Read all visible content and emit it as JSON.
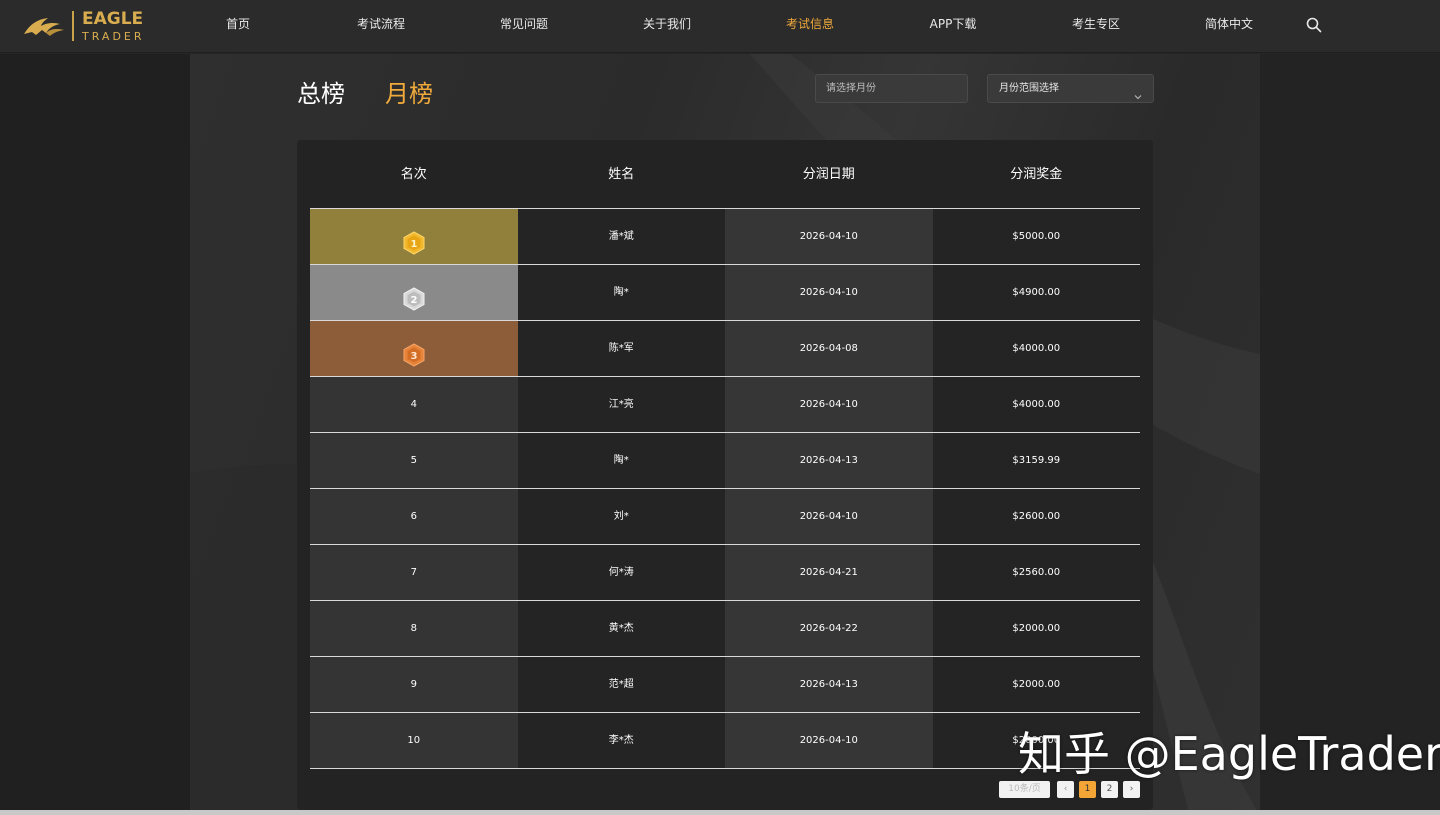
{
  "colors": {
    "accent": "#f0a93b",
    "gold_cell": "#917f3c",
    "silver_cell": "#8a8a8a",
    "bronze_cell": "#8d5d3a",
    "logo_gold": "#d9ad4f"
  },
  "logo": {
    "line1": "EAGLE",
    "line2": "TRADER",
    "icon": "eagle-logo-icon"
  },
  "nav": {
    "items": [
      {
        "label": "首页"
      },
      {
        "label": "考试流程"
      },
      {
        "label": "常见问题"
      },
      {
        "label": "关于我们"
      },
      {
        "label": "考试信息",
        "active": true
      },
      {
        "label": "APP下载"
      },
      {
        "label": "考生专区"
      },
      {
        "label": "简体中文"
      }
    ],
    "search_icon": "search-icon"
  },
  "tabs": {
    "total": "总榜",
    "month": "月榜",
    "active": "month"
  },
  "filters": {
    "month_placeholder": "请选择月份",
    "range_label": "月份范围选择",
    "range_icon": "chevron-down-icon"
  },
  "table": {
    "headers": [
      "名次",
      "姓名",
      "分润日期",
      "分润奖金"
    ],
    "rows": [
      {
        "rank": "1",
        "name": "潘*斌",
        "date": "2026-04-10",
        "bonus": "$5000.00"
      },
      {
        "rank": "2",
        "name": "陶*",
        "date": "2026-04-10",
        "bonus": "$4900.00"
      },
      {
        "rank": "3",
        "name": "陈*军",
        "date": "2026-04-08",
        "bonus": "$4000.00"
      },
      {
        "rank": "4",
        "name": "江*亮",
        "date": "2026-04-10",
        "bonus": "$4000.00"
      },
      {
        "rank": "5",
        "name": "陶*",
        "date": "2026-04-13",
        "bonus": "$3159.99"
      },
      {
        "rank": "6",
        "name": "刘*",
        "date": "2026-04-10",
        "bonus": "$2600.00"
      },
      {
        "rank": "7",
        "name": "何*涛",
        "date": "2026-04-21",
        "bonus": "$2560.00"
      },
      {
        "rank": "8",
        "name": "黄*杰",
        "date": "2026-04-22",
        "bonus": "$2000.00"
      },
      {
        "rank": "9",
        "name": "范*超",
        "date": "2026-04-13",
        "bonus": "$2000.00"
      },
      {
        "rank": "10",
        "name": "李*杰",
        "date": "2026-04-10",
        "bonus": "$2000.00"
      }
    ]
  },
  "pagination": {
    "page_size": "10条/页",
    "prev": "‹",
    "pages": [
      "1",
      "2"
    ],
    "current": "1",
    "next": "›"
  },
  "watermark": "知乎 @EagleTrader"
}
